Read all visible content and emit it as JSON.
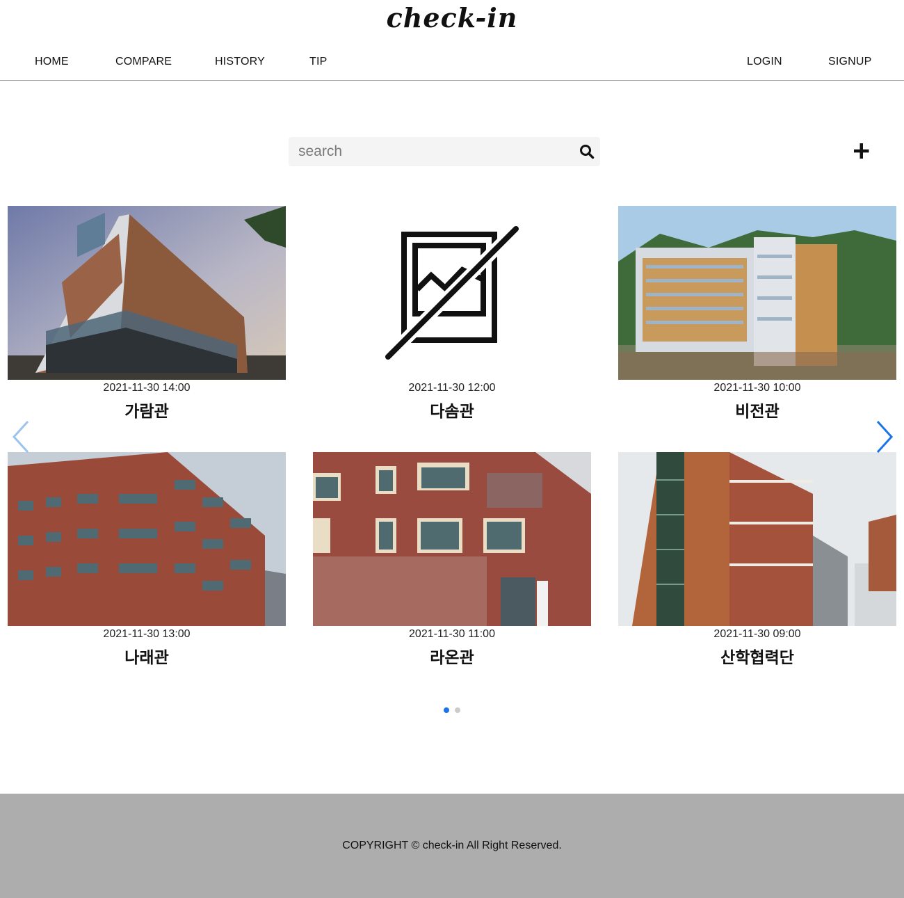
{
  "header": {
    "logo": "check-in"
  },
  "nav": {
    "left": [
      "HOME",
      "COMPARE",
      "HISTORY",
      "TIP"
    ],
    "right": [
      "LOGIN",
      "SIGNUP"
    ]
  },
  "search": {
    "placeholder": "search",
    "value": "",
    "icon": "search-icon"
  },
  "add_button": {
    "label": "+",
    "icon": "plus-icon"
  },
  "cards": [
    {
      "date": "2021-11-30 14:00",
      "name": "가람관",
      "image": "building-photo-brick-glass"
    },
    {
      "date": "2021-11-30 12:00",
      "name": "다솜관",
      "image": "no-image-icon"
    },
    {
      "date": "2021-11-30 10:00",
      "name": "비전관",
      "image": "building-photo-tall-hillside"
    },
    {
      "date": "2021-11-30 13:00",
      "name": "나래관",
      "image": "building-photo-brick-angled"
    },
    {
      "date": "2021-11-30 11:00",
      "name": "라온관",
      "image": "building-photo-brick-curved"
    },
    {
      "date": "2021-11-30 09:00",
      "name": "산학협력단",
      "image": "building-photo-brick-tower"
    }
  ],
  "carousel": {
    "prev_icon": "chevron-left-icon",
    "next_icon": "chevron-right-icon",
    "page_count": 2,
    "active_page": 1,
    "colors": {
      "arrow_prev": "#9cc3ee",
      "arrow_next": "#1a73e8",
      "dot_active": "#1a73e8",
      "dot_inactive": "#cccccc"
    }
  },
  "footer": {
    "copyright": "COPYRIGHT © check-in All Right Reserved."
  },
  "colors": {
    "footer_bg": "#adadad",
    "search_bg": "#f4f4f4",
    "nav_border": "#9a9a9a"
  }
}
